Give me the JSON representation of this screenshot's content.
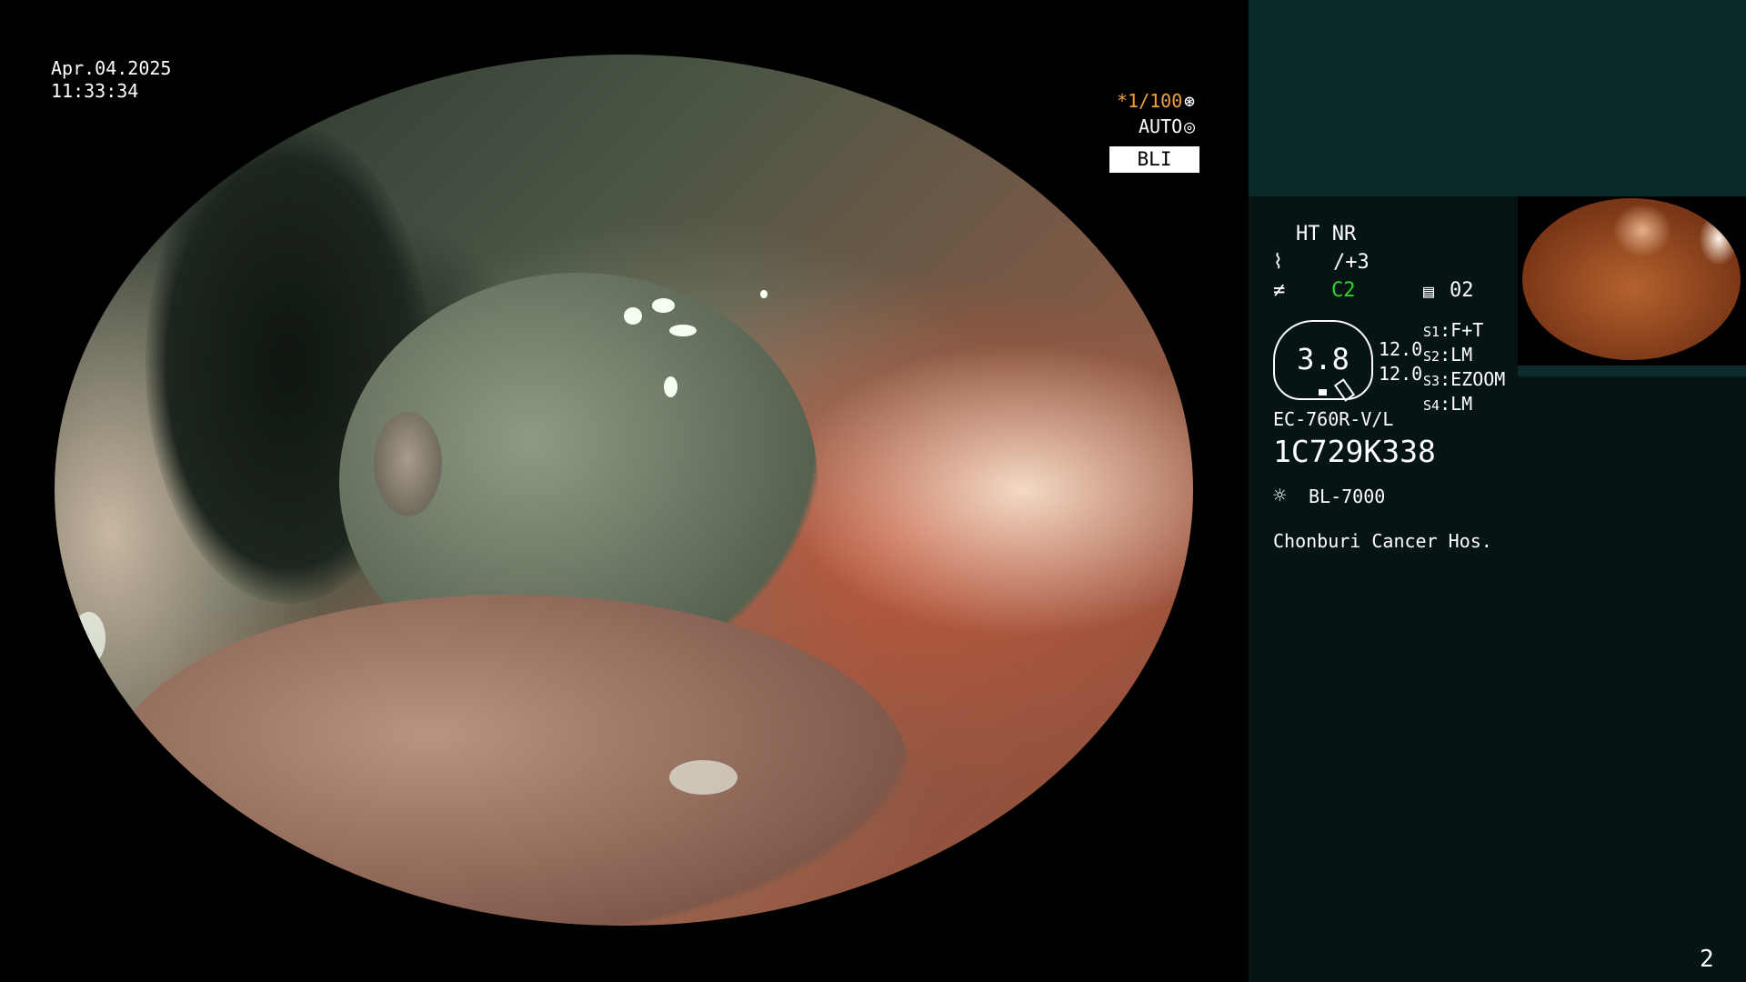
{
  "datetime": {
    "date": "Apr.04.2025",
    "time": "11:33:34"
  },
  "overlay": {
    "shutter": "*1/100",
    "shutter_icon": "aperture-icon",
    "iris": "AUTO",
    "iris_icon": "iris-icon",
    "mode": "BLI"
  },
  "panel": {
    "enhance": "HT NR",
    "structure_value": "/+3",
    "structure_icon": "structure-icon",
    "color_value": "C2",
    "color_icon": "color-enhance-icon",
    "page_icon": "page-icon",
    "page_value": "02",
    "zoom_value": "3.8",
    "scale_1": "12.0",
    "scale_2": "12.0",
    "switches": [
      {
        "key": "S1",
        "value": "F+T"
      },
      {
        "key": "S2",
        "value": "LM"
      },
      {
        "key": "S3",
        "value": "EZOOM"
      },
      {
        "key": "S4",
        "value": "LM"
      }
    ],
    "scope_model": "EC-760R-V/L",
    "serial": "1C729K338",
    "light_icon": "light-source-icon",
    "light_source": "BL-7000",
    "hospital": "Chonburi Cancer Hos."
  },
  "page_number": "2",
  "colors": {
    "accent_orange": "#f0a040",
    "accent_green": "#2fd52f",
    "panel_top": "#0a2a2a",
    "panel_bottom": "#071414"
  }
}
